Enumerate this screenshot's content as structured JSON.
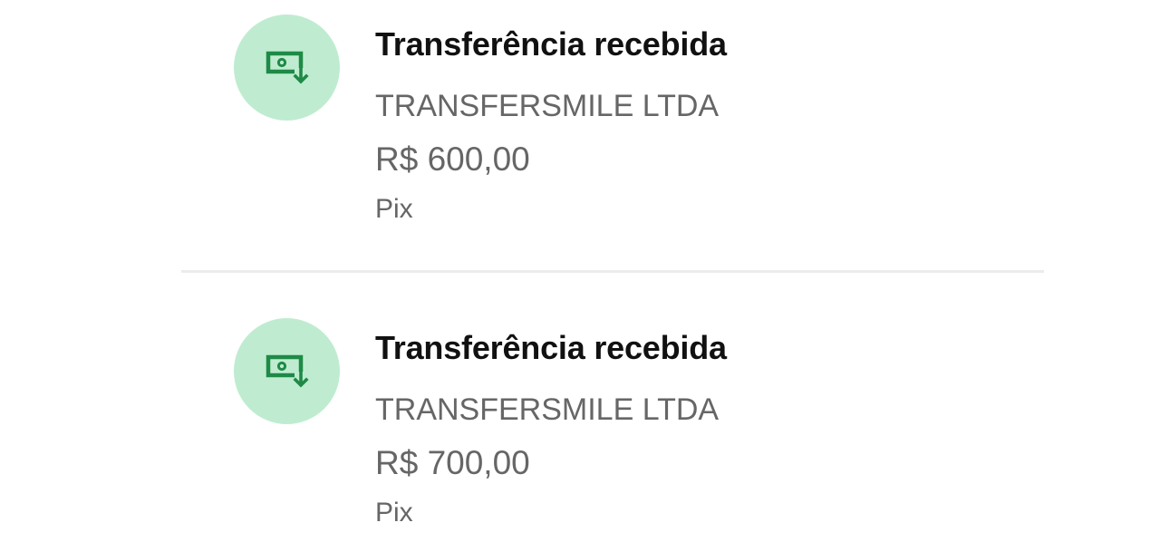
{
  "colors": {
    "icon_bg": "#bfecd0",
    "icon_fg": "#1e8a46",
    "title": "#111111",
    "secondary_text": "#666666",
    "divider": "#ececec"
  },
  "transactions": [
    {
      "icon": "money-received-icon",
      "title": "Transferência recebida",
      "counterparty": "TRANSFERSMILE LTDA",
      "amount": "R$ 600,00",
      "method": "Pix"
    },
    {
      "icon": "money-received-icon",
      "title": "Transferência recebida",
      "counterparty": "TRANSFERSMILE LTDA",
      "amount": "R$ 700,00",
      "method": "Pix"
    }
  ]
}
